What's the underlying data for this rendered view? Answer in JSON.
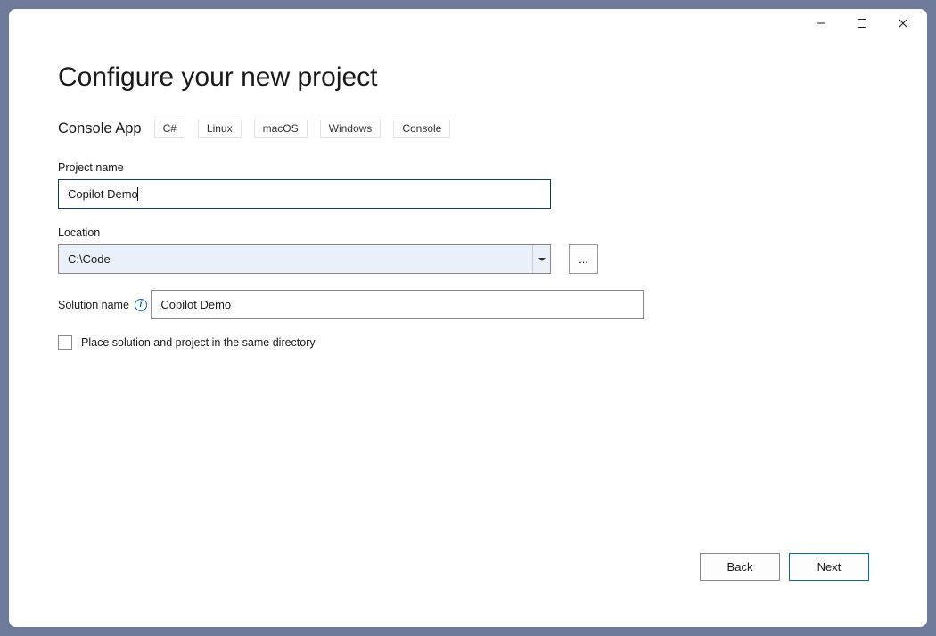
{
  "page": {
    "title": "Configure your new project"
  },
  "template": {
    "name": "Console App",
    "tags": [
      "C#",
      "Linux",
      "macOS",
      "Windows",
      "Console"
    ]
  },
  "form": {
    "project_name": {
      "label": "Project name",
      "value": "Copilot Demo"
    },
    "location": {
      "label": "Location",
      "value": "C:\\Code",
      "browse_label": "..."
    },
    "solution_name": {
      "label": "Solution name",
      "value": "Copilot Demo"
    },
    "same_dir_checkbox": {
      "label": "Place solution and project in the same directory",
      "checked": false
    }
  },
  "footer": {
    "back_label": "Back",
    "next_label": "Next"
  }
}
